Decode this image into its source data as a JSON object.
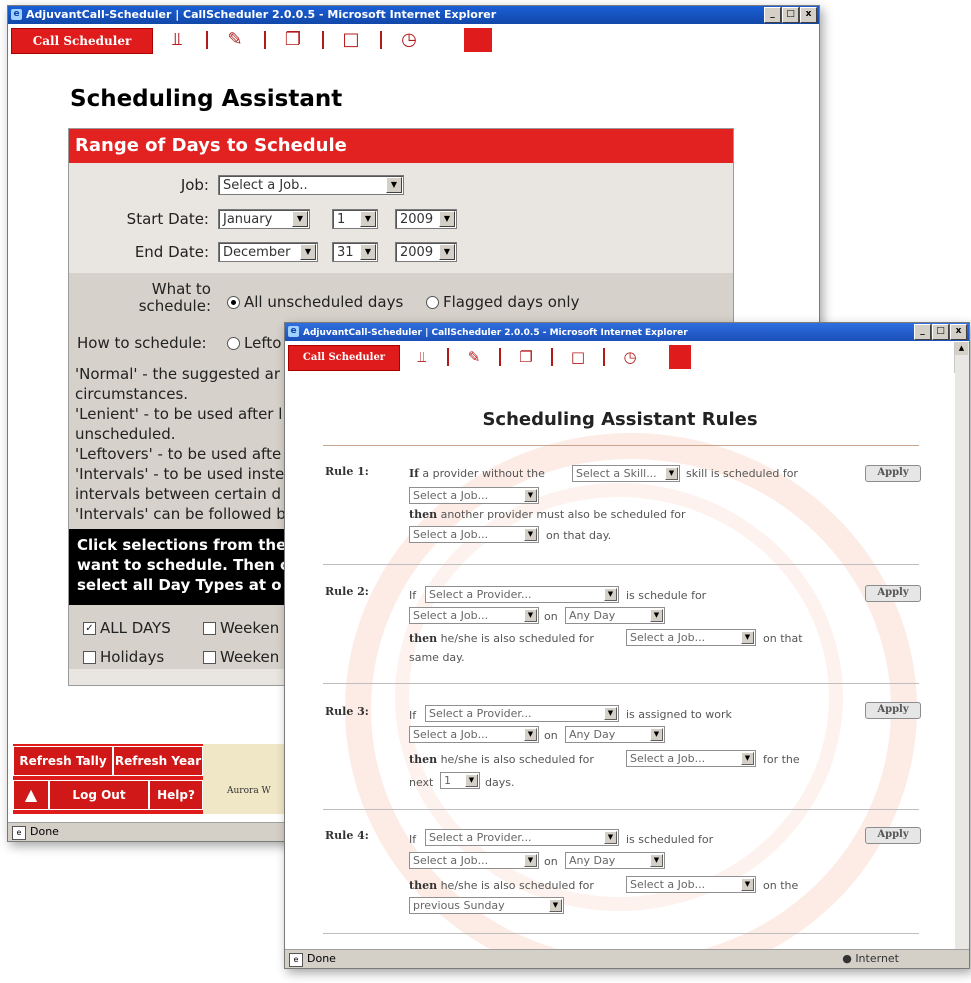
{
  "win1": {
    "title": "AdjuvantCall-Scheduler | CallScheduler 2.0.0.5 - Microsoft Internet Explorer",
    "controls": [
      "_",
      "□",
      "x"
    ],
    "logo": "Call Scheduler",
    "page_title": "Scheduling Assistant",
    "panel_title": "Range of Days to Schedule",
    "job_label": "Job:",
    "job_value": "Select a Job..",
    "start_label": "Start Date:",
    "start_month": "January",
    "start_day": "1",
    "start_year": "2009",
    "end_label": "End Date:",
    "end_month": "December",
    "end_day": "31",
    "end_year": "2009",
    "what_label_1": "What to",
    "what_label_2": "schedule:",
    "opt_all": "All unscheduled days",
    "opt_flagged": "Flagged days only",
    "how_label": "How to schedule:",
    "how_opt": "Lefto",
    "desc": [
      "'Normal' - the suggested ar",
      "circumstances.",
      "'Lenient' - to be used after l",
      "unscheduled.",
      "'Leftovers' - to be used afte",
      "'Intervals' - to be used inste",
      "intervals between certain d",
      "'Intervals' can be followed b"
    ],
    "black_lines": [
      "Click selections from the",
      "want to schedule. Then c",
      "select all Day Types at o"
    ],
    "day_all": "ALL DAYS",
    "day_weekend_1": "Weeken",
    "day_holidays": "Holidays",
    "day_weekend_2": "Weeken",
    "btn_refresh_tally": "Refresh Tally",
    "btn_refresh_year": "Refresh Year",
    "btn_logout": "Log Out",
    "btn_help": "Help?",
    "footer_text": "Aurora W",
    "status": "Done"
  },
  "win2": {
    "title": "AdjuvantCall-Scheduler | CallScheduler 2.0.0.5 - Microsoft Internet Explorer",
    "controls": [
      "_",
      "□",
      "x"
    ],
    "logo": "Call Scheduler",
    "heading": "Scheduling Assistant Rules",
    "apply_label": "Apply",
    "rules": [
      {
        "label": "Rule 1:",
        "if": "If",
        "t1": "a provider without the",
        "sel1": "Select a Skill...",
        "t2": "skill is scheduled for",
        "sel2": "Select a Job...",
        "then": "then",
        "t3": "another provider must also be scheduled for",
        "sel3": "Select a Job...",
        "t4": "on that day."
      },
      {
        "label": "Rule 2:",
        "if": "If",
        "sel1": "Select a Provider...",
        "t1": "is schedule for",
        "sel2": "Select a Job...",
        "on": "on",
        "sel3": "Any Day",
        "then": "then",
        "t2": "he/she is also scheduled for",
        "sel4": "Select a Job...",
        "t3": "on that",
        "t4": "same day."
      },
      {
        "label": "Rule 3:",
        "if": "If",
        "sel1": "Select a Provider...",
        "t1": "is assigned to work",
        "sel2": "Select a Job...",
        "on": "on",
        "sel3": "Any Day",
        "then": "then",
        "t2": "he/she is also scheduled for",
        "sel4": "Select a Job...",
        "t3": "for the",
        "t4": "next",
        "sel5": "1",
        "t5": "days."
      },
      {
        "label": "Rule 4:",
        "if": "If",
        "sel1": "Select a Provider...",
        "t1": "is scheduled for",
        "sel2": "Select a Job...",
        "on": "on",
        "sel3": "Any Day",
        "then": "then",
        "t2": "he/she is also scheduled for",
        "sel4": "Select a Job...",
        "t3": "on the",
        "sel5": "previous Sunday"
      }
    ],
    "status": "Done",
    "zone": "Internet"
  },
  "colors": {
    "brand_red": "#e01b1b",
    "panel_bg": "#e9e5e0",
    "title_blue": "#1a5fd6"
  },
  "icons": [
    "fork-knife-icon",
    "notepad-pencil-icon",
    "copy-icon",
    "edit-box-icon",
    "clock-icon"
  ]
}
